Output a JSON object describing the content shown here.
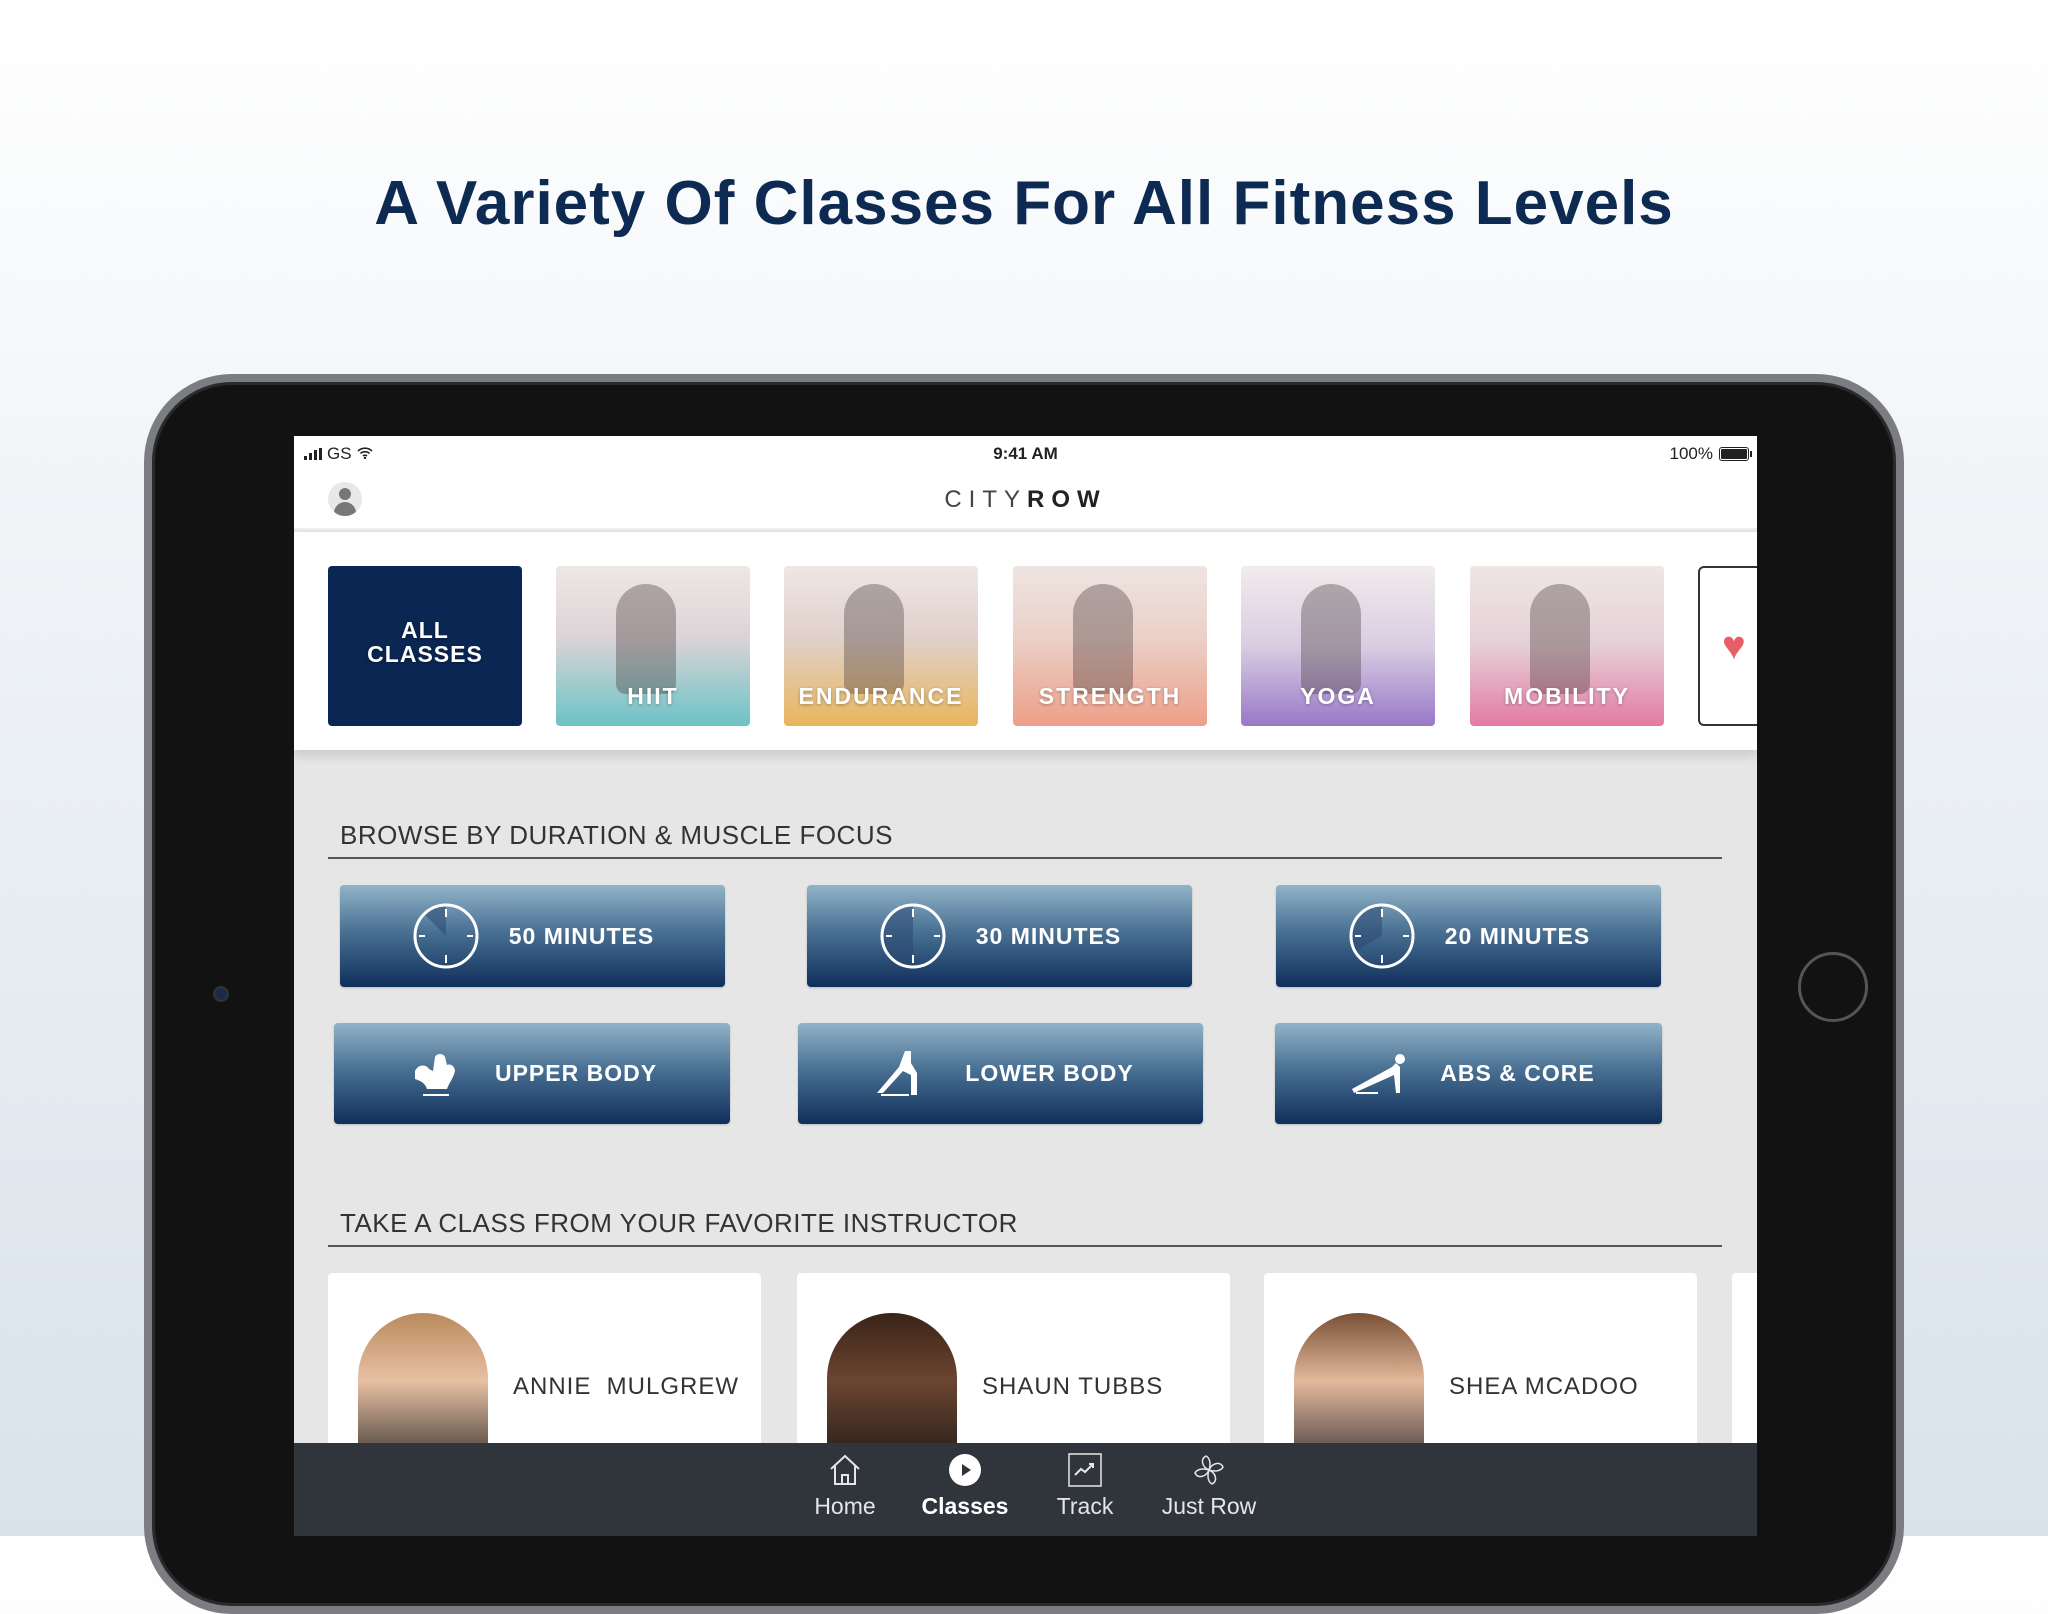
{
  "headline": "A Variety Of Classes For All Fitness Levels",
  "status_bar": {
    "carrier": "GS",
    "time": "9:41 AM",
    "battery": "100%"
  },
  "header": {
    "logo_light": "CITY",
    "logo_bold": "ROW",
    "avatar_icon": "user-avatar-icon"
  },
  "categories": [
    {
      "label": "ALL CLASSES",
      "line1": "ALL",
      "line2": "CLASSES",
      "color": "#0a2653"
    },
    {
      "label": "HIIT",
      "tint": "#6cc3c6"
    },
    {
      "label": "ENDURANCE",
      "tint": "#e9b65c"
    },
    {
      "label": "STRENGTH",
      "tint": "#ee9f88"
    },
    {
      "label": "YOGA",
      "tint": "#9978c8"
    },
    {
      "label": "MOBILITY",
      "tint": "#e47aa3"
    }
  ],
  "favorites": {
    "icon": "heart-icon",
    "color": "#e85e66"
  },
  "browse": {
    "title": "BROWSE BY DURATION & MUSCLE FOCUS",
    "duration_buttons": [
      {
        "label": "50 MINUTES",
        "icon": "clock-50-icon"
      },
      {
        "label": "30 MINUTES",
        "icon": "clock-30-icon"
      },
      {
        "label": "20 MINUTES",
        "icon": "clock-20-icon"
      }
    ],
    "focus_buttons": [
      {
        "label": "UPPER BODY",
        "icon": "flex-arm-icon"
      },
      {
        "label": "LOWER BODY",
        "icon": "lunge-icon"
      },
      {
        "label": "ABS & CORE",
        "icon": "plank-icon"
      }
    ]
  },
  "instructors": {
    "title": "TAKE A CLASS FROM YOUR FAVORITE INSTRUCTOR",
    "items": [
      {
        "name": "ANNIE  MULGREW"
      },
      {
        "name": "SHAUN TUBBS"
      },
      {
        "name": "SHEA MCADOO"
      }
    ]
  },
  "tabbar": {
    "items": [
      {
        "label": "Home",
        "icon": "home-icon",
        "active": false
      },
      {
        "label": "Classes",
        "icon": "play-circle-icon",
        "active": true
      },
      {
        "label": "Track",
        "icon": "trend-chart-icon",
        "active": false
      },
      {
        "label": "Just Row",
        "icon": "rower-fan-icon",
        "active": false
      }
    ]
  }
}
